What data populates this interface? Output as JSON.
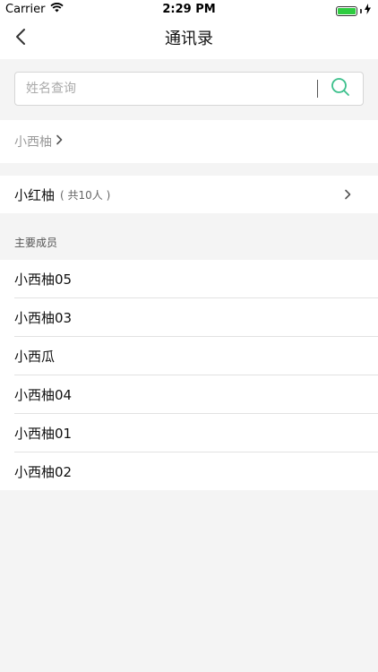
{
  "status_bar": {
    "carrier": "Carrier",
    "time": "2:29 PM",
    "battery_level": 1.0
  },
  "nav": {
    "title": "通讯录",
    "back_icon": "chevron-left-icon"
  },
  "search": {
    "placeholder": "姓名查询",
    "value": "",
    "icon": "search-icon",
    "accent_color": "#3cc08c"
  },
  "breadcrumb": {
    "label": "小西柚"
  },
  "group": {
    "name": "小红柚",
    "count_label": "( 共10人 )"
  },
  "members_section": {
    "title": "主要成员",
    "items": [
      {
        "name": "小西柚05"
      },
      {
        "name": "小西柚03"
      },
      {
        "name": "小西瓜"
      },
      {
        "name": "小西柚04"
      },
      {
        "name": "小西柚01"
      },
      {
        "name": "小西柚02"
      }
    ]
  }
}
